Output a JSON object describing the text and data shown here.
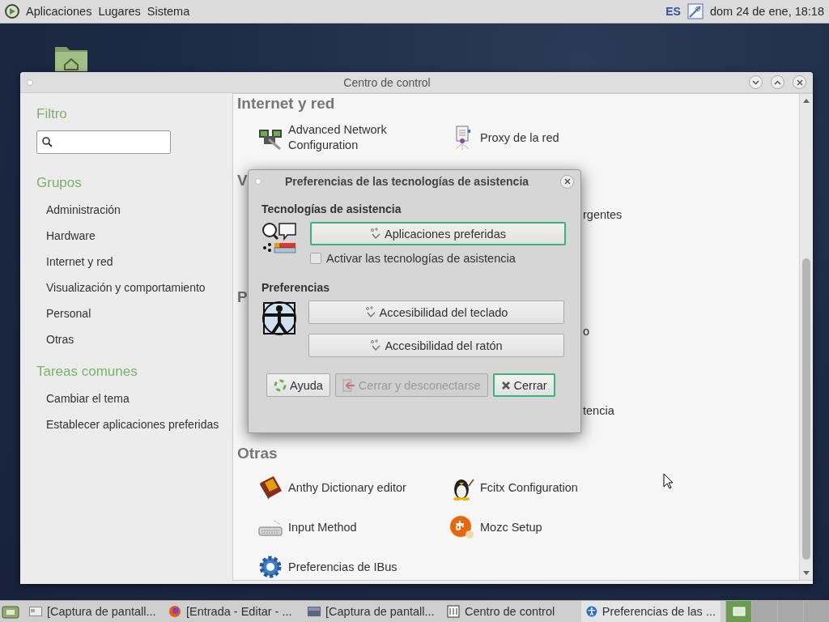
{
  "top_panel": {
    "menus": [
      "Aplicaciones",
      "Lugares",
      "Sistema"
    ],
    "keyboard_layout": "ES",
    "clock": "dom 24 de ene, 18:18"
  },
  "window": {
    "title": "Centro de control"
  },
  "sidebar": {
    "sections": [
      {
        "heading": "Filtro",
        "kind": "search"
      },
      {
        "heading": "Grupos",
        "kind": "links",
        "items": [
          "Administración",
          "Hardware",
          "Internet y red",
          "Visualización y comportamiento",
          "Personal",
          "Otras"
        ]
      },
      {
        "heading": "Tareas comunes",
        "kind": "links",
        "items": [
          "Cambiar el tema",
          "Establecer aplicaciones preferidas"
        ]
      }
    ]
  },
  "content": [
    {
      "kind": "heading",
      "text": "Internet y red"
    },
    {
      "kind": "row",
      "items": [
        "Advanced Network Configuration",
        "Proxy de la red"
      ]
    },
    {
      "kind": "heading",
      "text": "V"
    },
    {
      "kind": "covered",
      "fragment": "rgentes"
    },
    {
      "kind": "hidden"
    },
    {
      "kind": "heading",
      "text": "P"
    },
    {
      "kind": "covered",
      "fragment": "o"
    },
    {
      "kind": "hidden"
    },
    {
      "kind": "covered",
      "fragment": "tencia"
    },
    {
      "kind": "heading",
      "text": "Otras"
    },
    {
      "kind": "row",
      "items": [
        "Anthy Dictionary editor",
        "Fcitx Configuration"
      ]
    },
    {
      "kind": "row",
      "items": [
        "Input Method",
        "Mozc Setup"
      ]
    },
    {
      "kind": "row",
      "items": [
        "Preferencias de IBus"
      ]
    }
  ],
  "dialog": {
    "title": "Preferencias de las tecnologías de asistencia",
    "sections": [
      {
        "heading": "Tecnologías de asistencia",
        "buttons": [
          {
            "label": "Aplicaciones preferidas",
            "focused": true
          }
        ],
        "checkbox": {
          "label": "Activar las tecnologías de asistencia",
          "checked": false
        }
      },
      {
        "heading": "Preferencias",
        "buttons": [
          {
            "label": "Accesibilidad del teclado",
            "focused": false
          },
          {
            "label": "Accesibilidad del ratón",
            "focused": false
          }
        ]
      }
    ],
    "actions": [
      {
        "label": "Ayuda",
        "disabled": false,
        "focused": false
      },
      {
        "label": "Cerrar y desconectarse",
        "disabled": true,
        "focused": false
      },
      {
        "label": "Cerrar",
        "disabled": false,
        "focused": true
      }
    ]
  },
  "taskbar": {
    "tasks": [
      {
        "label": "[Captura de pantall...",
        "selected": false
      },
      {
        "label": "[Entrada - Editar - ...",
        "selected": false
      },
      {
        "label": "[Captura de pantall...",
        "selected": false
      },
      {
        "label": "Centro de control",
        "selected": false
      },
      {
        "label": "Preferencias de las ...",
        "selected": true
      }
    ],
    "workspaces": [
      {
        "selected": true
      },
      {
        "selected": false
      },
      {
        "selected": false
      },
      {
        "selected": false
      }
    ]
  }
}
